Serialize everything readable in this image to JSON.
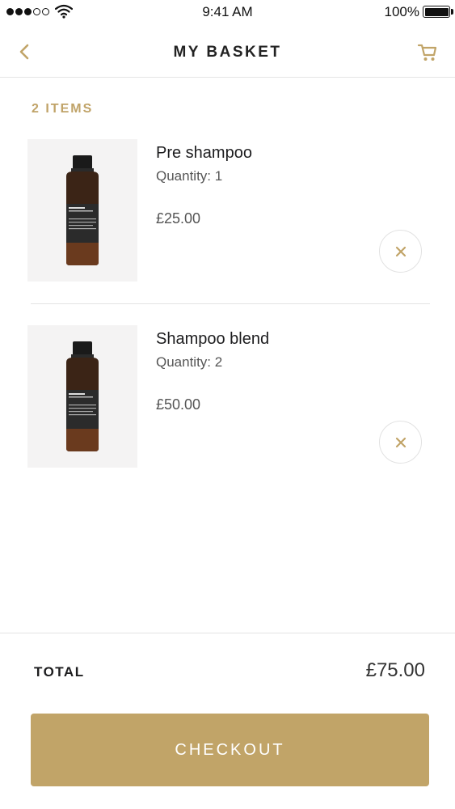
{
  "status_bar": {
    "time": "9:41 AM",
    "battery_percent": "100%",
    "signal_bars_filled": 3,
    "signal_bars_total": 5
  },
  "nav": {
    "title": "MY BASKET",
    "back_icon": "chevron-left-icon",
    "cart_icon": "cart-icon"
  },
  "basket": {
    "items_count_label": "2 ITEMS",
    "items": [
      {
        "name": "Pre shampoo",
        "quantity": "Quantity: 1",
        "price": "£25.00"
      },
      {
        "name": "Shampoo blend",
        "quantity": "Quantity: 2",
        "price": "£50.00"
      }
    ],
    "remove_icon": "close-icon"
  },
  "footer": {
    "total_label": "TOTAL",
    "total_value": "£75.00",
    "checkout_label": "CHECKOUT"
  },
  "colors": {
    "accent": "#c1a468",
    "text": "#1d1d1f",
    "divider": "#e3e3e3"
  }
}
